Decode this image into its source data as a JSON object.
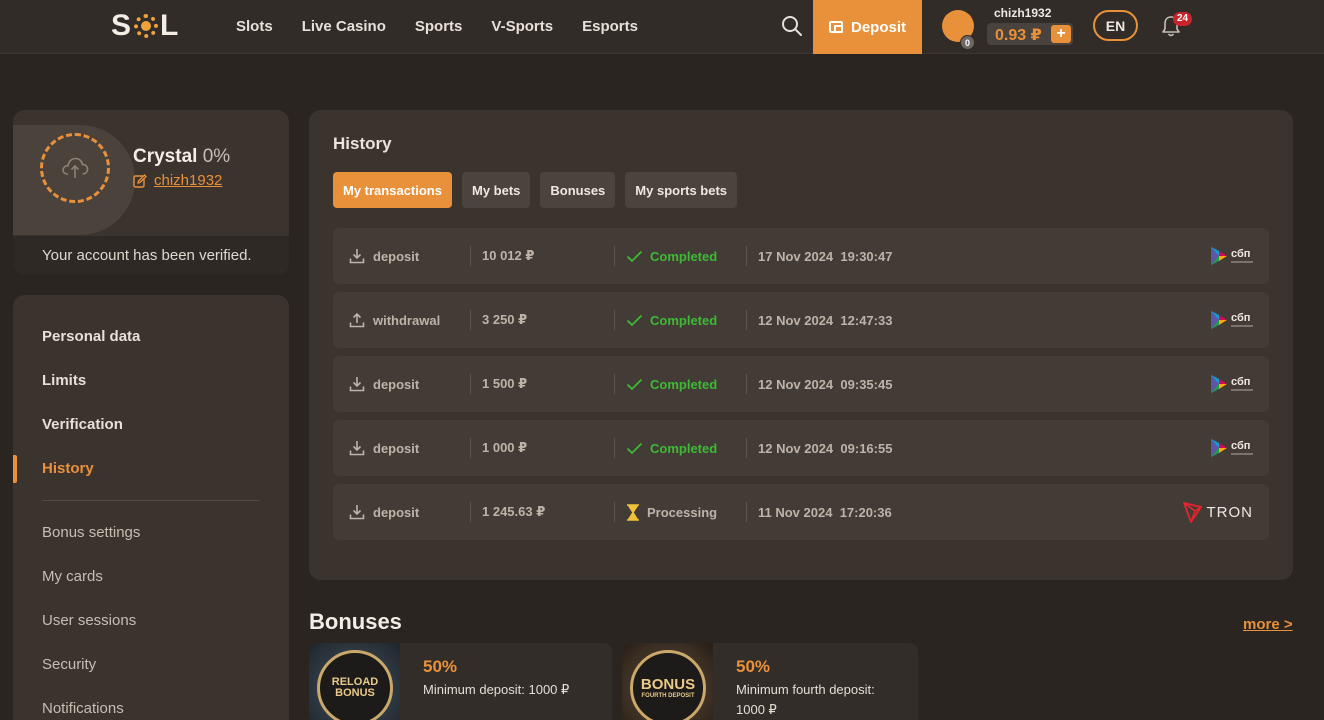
{
  "header": {
    "logo": "SOL",
    "nav": [
      "Slots",
      "Live Casino",
      "Sports",
      "V-Sports",
      "Esports"
    ],
    "deposit_label": "Deposit",
    "username": "chizh1932",
    "avatar_badge": "0",
    "balance": "0.93 ₽",
    "plus": "+",
    "language": "EN",
    "notifications": "24"
  },
  "profile": {
    "name": "Crystal",
    "percent": "0%",
    "login": "chizh1932",
    "verified_text": "Your account has been verified."
  },
  "sidebar": {
    "items": [
      {
        "label": "Personal data"
      },
      {
        "label": "Limits"
      },
      {
        "label": "Verification"
      },
      {
        "label": "History"
      },
      {
        "label": "Bonus settings"
      },
      {
        "label": "My cards"
      },
      {
        "label": "User sessions"
      },
      {
        "label": "Security"
      },
      {
        "label": "Notifications"
      }
    ],
    "active": "History"
  },
  "history": {
    "title": "History",
    "tabs": [
      "My transactions",
      "My bets",
      "Bonuses",
      "My sports bets"
    ],
    "active_tab": "My transactions",
    "transactions": [
      {
        "type": "deposit",
        "amount": "10 012 ₽",
        "status": "Completed",
        "date": "17 Nov 2024",
        "time": "19:30:47",
        "method": "сбп"
      },
      {
        "type": "withdrawal",
        "amount": "3 250 ₽",
        "status": "Completed",
        "date": "12 Nov 2024",
        "time": "12:47:33",
        "method": "сбп"
      },
      {
        "type": "deposit",
        "amount": "1 500 ₽",
        "status": "Completed",
        "date": "12 Nov 2024",
        "time": "09:35:45",
        "method": "сбп"
      },
      {
        "type": "deposit",
        "amount": "1 000 ₽",
        "status": "Completed",
        "date": "12 Nov 2024",
        "time": "09:16:55",
        "method": "сбп"
      },
      {
        "type": "deposit",
        "amount": "1 245.63 ₽",
        "status": "Processing",
        "date": "11 Nov 2024",
        "time": "17:20:36",
        "method": "TRON"
      }
    ]
  },
  "bonuses": {
    "title": "Bonuses",
    "more": "more >",
    "cards": [
      {
        "percent": "50%",
        "desc": "Minimum deposit: 1000 ₽",
        "medal_top": "RELOAD",
        "medal_main": "BONUS"
      },
      {
        "percent": "50%",
        "desc": "Minimum fourth deposit: 1000 ₽",
        "medal_top": "",
        "medal_main": "BONUS",
        "medal_sub": "FOURTH DEPOSIT"
      }
    ]
  },
  "colors": {
    "accent": "#e9913a",
    "success": "#3dbb36",
    "background": "#2a2521",
    "panel": "#3a332e"
  }
}
